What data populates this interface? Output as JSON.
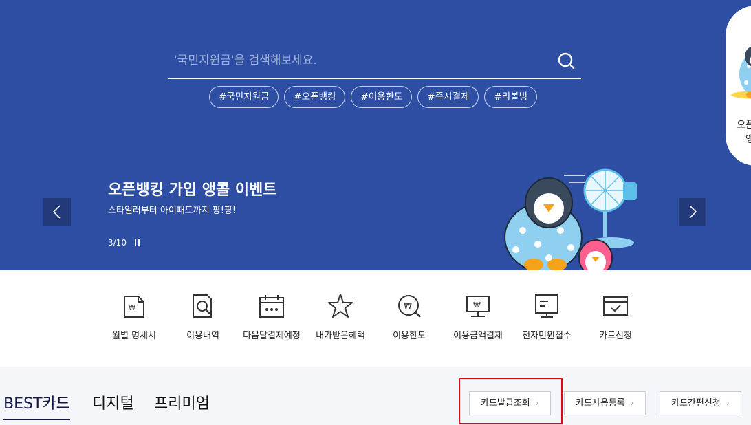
{
  "search": {
    "placeholder": "'국민지원금'을 검색해보세요.",
    "tags": [
      "#국민지원금",
      "#오픈뱅킹",
      "#이용한도",
      "#즉시결제",
      "#리볼빙"
    ]
  },
  "side_promo": {
    "text": "오픈뱅킹 앵콜"
  },
  "slider": {
    "title": "오픈뱅킹 가입 앵콜 이벤트",
    "subtitle": "스타일러부터 아이패드까지 팡!팡!",
    "counter": "3/10"
  },
  "quick_menu": [
    {
      "label": "월별 명세서",
      "icon": "statement-icon"
    },
    {
      "label": "이용내역",
      "icon": "usage-history-icon"
    },
    {
      "label": "다음달결제예정",
      "icon": "calendar-icon"
    },
    {
      "label": "내가받은혜택",
      "icon": "benefit-star-icon"
    },
    {
      "label": "이용한도",
      "icon": "limit-icon"
    },
    {
      "label": "이용금액결제",
      "icon": "payment-monitor-icon"
    },
    {
      "label": "전자민원접수",
      "icon": "complaint-monitor-icon"
    },
    {
      "label": "카드신청",
      "icon": "card-apply-icon"
    }
  ],
  "card_tabs": [
    "BEST카드",
    "디지털",
    "프리미엄"
  ],
  "card_buttons": [
    "카드발급조회",
    "카드사용등록",
    "카드간편신청"
  ],
  "colors": {
    "hero_bg": "#2d4ea3",
    "arrow_bg": "#22397a",
    "tab_active": "#14174a",
    "highlight": "#e30613"
  }
}
